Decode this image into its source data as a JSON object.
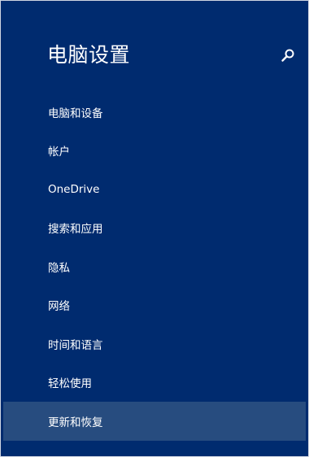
{
  "header": {
    "title": "电脑设置",
    "search_icon": "search-icon"
  },
  "nav": {
    "items": [
      {
        "label": "电脑和设备"
      },
      {
        "label": "帐户"
      },
      {
        "label": "OneDrive"
      },
      {
        "label": "搜索和应用"
      },
      {
        "label": "隐私"
      },
      {
        "label": "网络"
      },
      {
        "label": "时间和语言"
      },
      {
        "label": "轻松使用"
      },
      {
        "label": "更新和恢复",
        "selected": true
      }
    ]
  },
  "colors": {
    "background": "#002b6f",
    "selected": "#274c7f",
    "text": "#ffffff"
  }
}
